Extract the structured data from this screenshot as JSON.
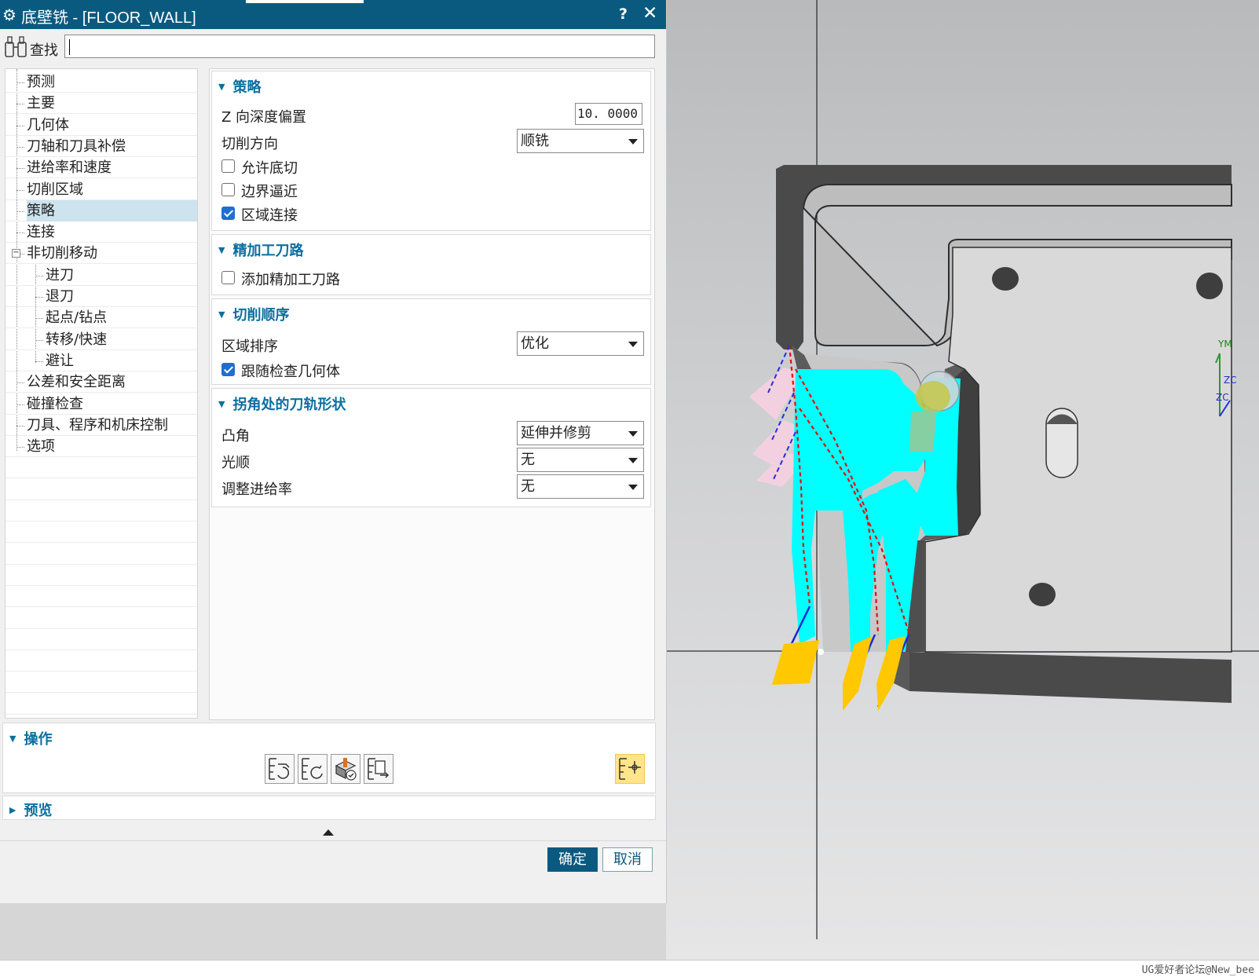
{
  "dialog": {
    "title": "底壁铣 - [FLOOR_WALL]",
    "help": "?",
    "close": "✕",
    "gear_glyph": "⚙"
  },
  "search": {
    "label": "查找",
    "value": ""
  },
  "nav": {
    "items": [
      {
        "label": "预测",
        "level": 0
      },
      {
        "label": "主要",
        "level": 0
      },
      {
        "label": "几何体",
        "level": 0
      },
      {
        "label": "刀轴和刀具补偿",
        "level": 0
      },
      {
        "label": "进给率和速度",
        "level": 0
      },
      {
        "label": "切削区域",
        "level": 0
      },
      {
        "label": "策略",
        "level": 0,
        "selected": true
      },
      {
        "label": "连接",
        "level": 0
      },
      {
        "label": "非切削移动",
        "level": 0,
        "expanded": true
      },
      {
        "label": "进刀",
        "level": 1
      },
      {
        "label": "退刀",
        "level": 1
      },
      {
        "label": "起点/钻点",
        "level": 1
      },
      {
        "label": "转移/快速",
        "level": 1
      },
      {
        "label": "避让",
        "level": 1
      },
      {
        "label": "公差和安全距离",
        "level": 0
      },
      {
        "label": "碰撞检查",
        "level": 0
      },
      {
        "label": "刀具、程序和机床控制",
        "level": 0
      },
      {
        "label": "选项",
        "level": 0
      }
    ]
  },
  "groups": {
    "strategy": {
      "title": "策略",
      "z_offset_label": "Z 向深度偏置",
      "z_offset_value": "10. 0000",
      "cut_direction_label": "切削方向",
      "cut_direction_value": "顺铣",
      "allow_undercut": {
        "label": "允许底切",
        "checked": false
      },
      "boundary_approach": {
        "label": "边界逼近",
        "checked": false
      },
      "region_connect": {
        "label": "区域连接",
        "checked": true
      }
    },
    "finish_path": {
      "title": "精加工刀路",
      "add_finish": {
        "label": "添加精加工刀路",
        "checked": false
      }
    },
    "cut_order": {
      "title": "切削顺序",
      "region_sort_label": "区域排序",
      "region_sort_value": "优化",
      "follow_check": {
        "label": "跟随检查几何体",
        "checked": true
      }
    },
    "corner": {
      "title": "拐角处的刀轨形状",
      "convex_label": "凸角",
      "convex_value": "延伸并修剪",
      "smooth_label": "光顺",
      "smooth_value": "无",
      "feed_adjust_label": "调整进给率",
      "feed_adjust_value": "无"
    }
  },
  "operations": {
    "title": "操作",
    "buttons": [
      "generate-icon",
      "replay-icon",
      "verify-icon",
      "list-icon",
      "edit-display-icon"
    ]
  },
  "preview": {
    "title": "预览"
  },
  "footer": {
    "ok": "确定",
    "cancel": "取消"
  },
  "viewport": {
    "axis_labels": {
      "ym": "YM",
      "zc": "ZC",
      "xc": "ZC"
    },
    "watermark": "UG爱好者论坛@New_bee"
  },
  "colors": {
    "title_bar": "#0a5a7f",
    "group_header": "#0b6fa0",
    "toolpath_cyan": "#00ffff",
    "tool_yellow": "#ffc800",
    "selected_nav": "#cde3ee"
  }
}
